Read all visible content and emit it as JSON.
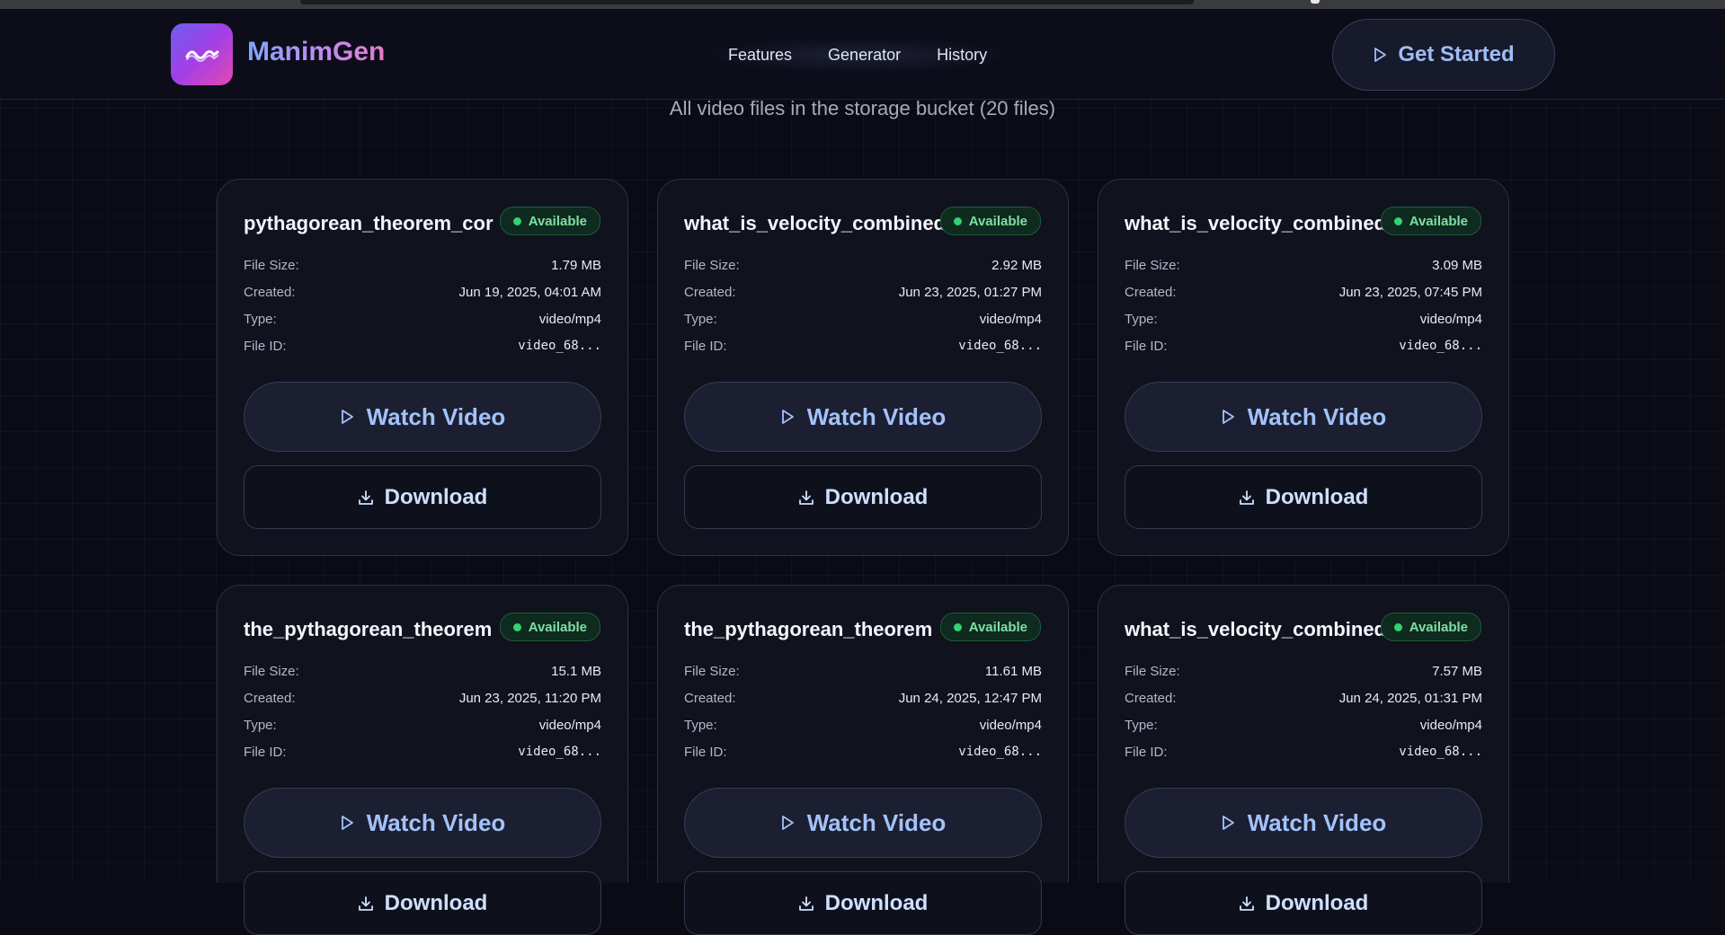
{
  "brand": {
    "name": "ManimGen"
  },
  "nav": {
    "items": [
      "Features",
      "Generator",
      "History"
    ]
  },
  "header": {
    "cta_label": "Get Started"
  },
  "page": {
    "subtitle": "All video files in the storage bucket (20 files)"
  },
  "labels": {
    "file_size": "File Size:",
    "created": "Created:",
    "type": "Type:",
    "file_id": "File ID:",
    "watch": "Watch Video",
    "download": "Download"
  },
  "cards": [
    {
      "title": "pythagorean_theorem_cor",
      "status": "Available",
      "size": "1.79 MB",
      "created": "Jun 19, 2025, 04:01 AM",
      "type": "video/mp4",
      "file_id": "video_68..."
    },
    {
      "title": "what_is_velocity_combined",
      "status": "Available",
      "size": "2.92 MB",
      "created": "Jun 23, 2025, 01:27 PM",
      "type": "video/mp4",
      "file_id": "video_68..."
    },
    {
      "title": "what_is_velocity_combined",
      "status": "Available",
      "size": "3.09 MB",
      "created": "Jun 23, 2025, 07:45 PM",
      "type": "video/mp4",
      "file_id": "video_68..."
    },
    {
      "title": "the_pythagorean_theorem",
      "status": "Available",
      "size": "15.1 MB",
      "created": "Jun 23, 2025, 11:20 PM",
      "type": "video/mp4",
      "file_id": "video_68..."
    },
    {
      "title": "the_pythagorean_theorem",
      "status": "Available",
      "size": "11.61 MB",
      "created": "Jun 24, 2025, 12:47 PM",
      "type": "video/mp4",
      "file_id": "video_68..."
    },
    {
      "title": "what_is_velocity_combined",
      "status": "Available",
      "size": "7.57 MB",
      "created": "Jun 24, 2025, 01:31 PM",
      "type": "video/mp4",
      "file_id": "video_68..."
    }
  ],
  "icons": {
    "logo": "wave-icon",
    "play": "play-icon",
    "download": "download-icon",
    "status": "status-dot"
  },
  "colors": {
    "available": "#35d074",
    "accent": "#a3c2fa",
    "brand_gradient_start": "#6d5ef0",
    "brand_gradient_end": "#e548b0"
  }
}
